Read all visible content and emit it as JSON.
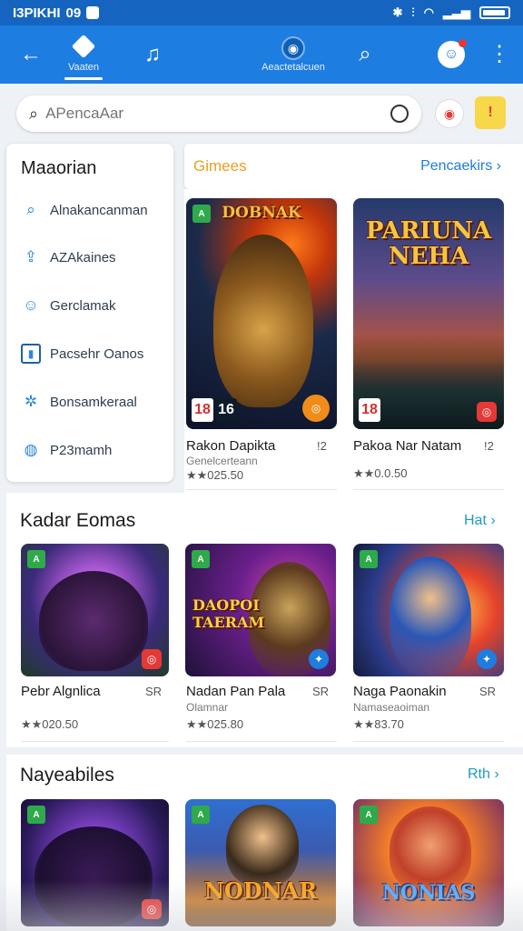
{
  "status_bar": {
    "carrier": "I3PIKHI",
    "time": "09"
  },
  "app_bar": {
    "back_icon": "back-arrow-icon",
    "tabs": [
      {
        "icon": "cube-icon",
        "label": "Vaaten",
        "active": true
      },
      {
        "icon": "music-note-icon",
        "label": ""
      },
      {
        "icon": "globe-icon",
        "label": "Aeactetalcuen"
      },
      {
        "icon": "search-icon",
        "label": ""
      }
    ],
    "profile_icon": "avatar-icon",
    "more_icon": "more-vert-icon"
  },
  "search": {
    "placeholder": "APencaAar",
    "value": ""
  },
  "side_menu": {
    "title": "Maaorian",
    "items": [
      {
        "icon": "search-icon",
        "label": "Alnakancanman"
      },
      {
        "icon": "upload-icon",
        "label": "AZAkaines"
      },
      {
        "icon": "user-icon",
        "label": "Gerclamak"
      },
      {
        "icon": "book-icon",
        "label": "Pacsehr Oanos"
      },
      {
        "icon": "compass-icon",
        "label": "Bonsamkeraal"
      },
      {
        "icon": "chat-icon",
        "label": "P23mamh"
      }
    ]
  },
  "games_header": {
    "title": "Gimees",
    "link": "Pencaekirs ›"
  },
  "featured": [
    {
      "title": "Rakon Dapikta",
      "badge_num": "!2",
      "subtitle": "Genelcerteann",
      "rating": "★★025.50",
      "art_title": "DOBNAK",
      "age": [
        "18",
        "16"
      ]
    },
    {
      "title": "Pakoa Nar Natam",
      "badge_num": "!2",
      "subtitle": "",
      "rating": "★★0.0.50",
      "art_title": "PARIUNA NEHA",
      "age": [
        "18"
      ]
    }
  ],
  "section1": {
    "title": "Kadar Eomas",
    "link": "Hat ›",
    "cards": [
      {
        "title": "Pebr Algnlica",
        "num": "SR",
        "subtitle": "",
        "rating": "★★020.50"
      },
      {
        "title": "Nadan Pan Pala",
        "num": "SR",
        "subtitle": "Olamnar",
        "rating": "★★025.80",
        "art_title": "DAOPOI TAERAM"
      },
      {
        "title": "Naga Paonakin",
        "num": "SR",
        "subtitle": "Namaseaoiman",
        "rating": "★★83.70"
      }
    ]
  },
  "section2": {
    "title": "Nayeabiles",
    "link": "Rth ›",
    "cards": [
      {
        "art_title": ""
      },
      {
        "art_title": "NODNAR"
      },
      {
        "art_title": "NONIAS"
      }
    ]
  }
}
